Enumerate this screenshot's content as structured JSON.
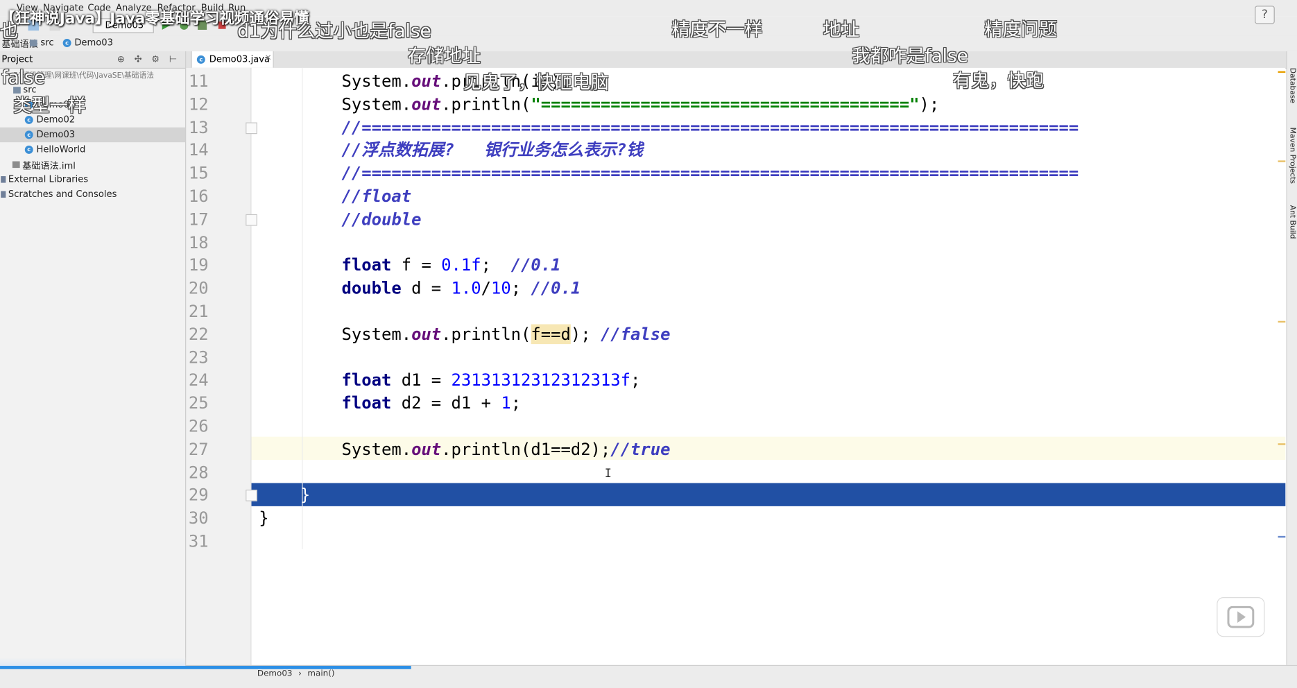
{
  "video_title": "【狂神说Java】Java零基础学习视频通俗易懂",
  "menu": [
    "View",
    "Navigate",
    "Code",
    "Analyze",
    "Refactor",
    "Build",
    "Run"
  ],
  "run_config": "Demo03",
  "breadcrumb": {
    "module": "基础语法",
    "folder": "src",
    "file": "Demo03"
  },
  "project_panel": {
    "title": "Project",
    "root_path": "F:\\班级管理\\网课班\\代码\\JavaSE\\基础语法",
    "root": "基础语法",
    "src": "src",
    "items": [
      "Demo01",
      "Demo02",
      "Demo03",
      "HelloWorld"
    ],
    "iml": "基础语法.iml",
    "external": "External Libraries",
    "scratches": "Scratches and Consoles"
  },
  "editor_tab": "Demo03.java",
  "line_numbers": [
    "11",
    "12",
    "13",
    "14",
    "15",
    "16",
    "17",
    "18",
    "19",
    "20",
    "21",
    "22",
    "23",
    "24",
    "25",
    "26",
    "27",
    "28",
    "29",
    "30",
    "31"
  ],
  "code": {
    "l11": {
      "a": "System.",
      "b": "out",
      "c": ".println(i3);"
    },
    "l12": {
      "a": "System.",
      "b": "out",
      "c": ".println(",
      "d": "\"=====================================\"",
      "e": ");"
    },
    "l13": "//========================================================================",
    "l14": "//浮点数拓展?   银行业务怎么表示?钱",
    "l15": "//========================================================================",
    "l16": "//float",
    "l17": "//double",
    "l19": {
      "kw": "float",
      "a": " f = ",
      "n": "0.1f",
      "b": ";  ",
      "cm": "//0.1"
    },
    "l20": {
      "kw": "double",
      "a": " d = ",
      "n1": "1.0",
      "s": "/",
      "n2": "10",
      "b": "; ",
      "cm": "//0.1"
    },
    "l22": {
      "a": "System.",
      "b": "out",
      "c": ".println(",
      "hl": "f==d",
      "d": "); ",
      "cm": "//false"
    },
    "l24": {
      "kw": "float",
      "a": " d1 = ",
      "n": "23131312312312313f",
      "b": ";"
    },
    "l25": {
      "kw": "float",
      "a": " d2 = d1 + ",
      "n": "1",
      "b": ";"
    },
    "l27": {
      "a": "System.",
      "b": "out",
      "c": ".println(d1==d2);",
      "cm": "//true"
    },
    "l29": "}",
    "l30": "}"
  },
  "status_crumbs": {
    "cls": "Demo03",
    "sep": "›",
    "method": "main()"
  },
  "side_tools": [
    "Database",
    "Maven Projects",
    "Ant Build"
  ],
  "danmaku": [
    "false",
    "类型一样",
    "d1为什么过小也是false",
    "存储地址",
    "见鬼了，快砸电脑",
    "精度不一样",
    "地址",
    "精度问题",
    "我都咋是false",
    "有鬼，快跑",
    "也"
  ],
  "help_label": "?"
}
